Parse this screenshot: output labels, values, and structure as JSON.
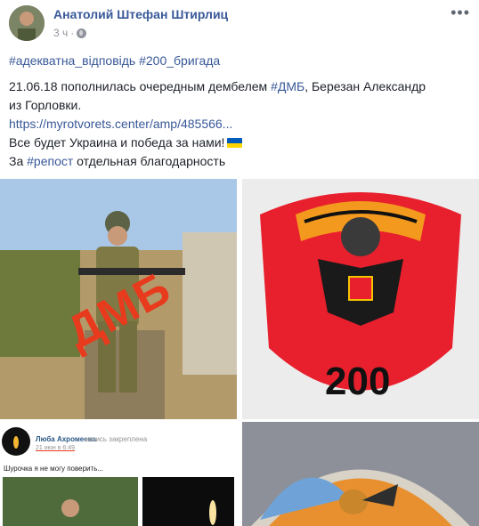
{
  "post": {
    "author": "Анатолий Штефан Штирлиц",
    "time": "3 ч",
    "separator": "·",
    "more": "•••",
    "hashtags": "#адекватна_відповідь #200_бригада",
    "line1_prefix": "21.06.18 пополнилась очередным дембелем ",
    "line1_tag": "#ДМБ",
    "line1_suffix": ", Березан Александр",
    "line2": "из Горловки.",
    "link": "https://myrotvorets.center/amp/485566...",
    "line4": "Все будет Украина и победа за нами!",
    "line5_prefix": "За ",
    "line5_tag": "#репост",
    "line5_suffix": " отдельная благодарность"
  },
  "images": {
    "photo_overlay": "ДМБ",
    "badge_number": "200",
    "vk_name": "Люба Ахромеева",
    "vk_pinned": "запись закреплена",
    "vk_date": "21 июн в 6:49",
    "vk_text": "Шурочка я не могу поверить..."
  },
  "colors": {
    "link": "#385898",
    "flag_blue": "#005bbb",
    "flag_yellow": "#ffd500",
    "badge_red": "#e8202d"
  }
}
